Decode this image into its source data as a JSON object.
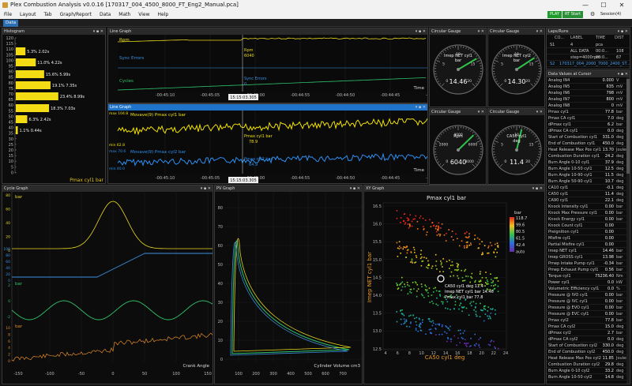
{
  "app": {
    "title": "Plex Combustion Analysis v0.0.16  [170317_004_4500_8000_FT_Eng2_Manual.pca]",
    "minimize": "—",
    "maximize": "☐",
    "close": "✕"
  },
  "menu": [
    "File",
    "Layout",
    "Tab",
    "Graph/Report",
    "Data",
    "Math",
    "View",
    "Help"
  ],
  "controls": {
    "play": "PLAY",
    "rtstart": "RT Start",
    "sessions": "Session(4)"
  },
  "tabs": {
    "active": "Data"
  },
  "histogram": {
    "title": "Histogram",
    "bars": [
      {
        "label": "5.3% 2.02s",
        "pct": 5.3
      },
      {
        "label": "11.0% 4.22s",
        "pct": 11.0
      },
      {
        "label": "15.6% 5.99s",
        "pct": 15.6
      },
      {
        "label": "19.1% 7.35s",
        "pct": 19.1
      },
      {
        "label": "23.4% 8.99s",
        "pct": 23.4
      },
      {
        "label": "18.3% 7.03s",
        "pct": 18.3
      },
      {
        "label": "6.3% 2.42s",
        "pct": 6.3
      },
      {
        "label": "1.1% 0.44s",
        "pct": 1.1
      }
    ],
    "yticks": [
      "120",
      "115",
      "110",
      "105",
      "100",
      "95",
      "90",
      "85",
      "80",
      "75",
      "70",
      "65",
      "60",
      "55",
      "50",
      "45",
      "40",
      "35",
      "30",
      "25",
      "20",
      "15",
      "10",
      "5",
      "0"
    ],
    "axis_label": "Pmax cyl1 bar"
  },
  "line_graph1": {
    "title": "Line Graph",
    "labels": {
      "rpm": "Rpm",
      "sync": "Sync Errors",
      "cycles": "Cycles",
      "time": "Time",
      "cursor_rpm": "Rpm",
      "cursor_rpm_val": "6040",
      "cursor_sync": "Sync Errors",
      "cursor_sync_val": "0"
    },
    "xticks": [
      "-00:45:10",
      "-00:45:05",
      "-00:45:00",
      "-00:44:55",
      "-00:44:50",
      "-00:44:45",
      "-00:44:40"
    ],
    "cursor_time": "15:15:03.305"
  },
  "line_graph2": {
    "title": "Line Graph",
    "labels": {
      "movave1": "Movave(9)  Pmax cyl1 bar",
      "movave2": "Movave(9)  Pmax cyl2 bar",
      "time": "Time",
      "max": "max 104.8",
      "min": "min 62.8",
      "max2": "max 70.6",
      "min2": "min 40.0",
      "c1": "Pmax cyl1 bar",
      "c1v": "78.9",
      "c2": "Pmax cyl2 bar",
      "c2v": "64.9"
    },
    "xticks": [
      "-00:45:10",
      "-00:45:05",
      "-00:45:00",
      "-00:44:55",
      "-00:44:50",
      "-00:44:45",
      "-00:44:40"
    ],
    "cursor_time": "15:15:03.305"
  },
  "gauges": [
    {
      "title": "Circular Gauge",
      "name": "Imep NET cyl1",
      "unit": "bar",
      "value": "14.46",
      "needle": 0.72,
      "ticks": [
        "0",
        "5",
        "10",
        "15",
        "20"
      ]
    },
    {
      "title": "Circular Gauge",
      "name": "Imep NET cyl2",
      "unit": "bar",
      "value": "14.30",
      "needle": 0.71,
      "ticks": [
        "0",
        "5",
        "10",
        "15",
        "20"
      ]
    },
    {
      "title": "Circular Gauge",
      "name": "Rpm",
      "unit": "",
      "value": "6040",
      "needle": 0.67,
      "ticks": [
        "0",
        "2000",
        "4000",
        "6000",
        "8000"
      ]
    },
    {
      "title": "Circular Gauge",
      "name": "CA50 cyl1",
      "unit": "deg",
      "value": "11.4",
      "needle": 0.55,
      "ticks": [
        "0",
        "5",
        "10",
        "15",
        "20"
      ]
    }
  ],
  "laps": {
    "title": "Laps/Runs",
    "headers": [
      "CO...",
      "LABEL",
      "TIME",
      "DIST"
    ],
    "rows": [
      [
        "S1",
        "4",
        "pca",
        ""
      ],
      [
        "",
        "ALL DATA",
        "00:0...",
        "108"
      ],
      [
        "",
        "step=4000rpm",
        "00:0...",
        "67"
      ],
      [
        "S2",
        "170317_004_2000_7000_2400_ST...",
        "",
        ""
      ]
    ]
  },
  "datavalues": {
    "title": "Data Values at Cursor",
    "rows": [
      [
        "Analog IN4",
        "0.000",
        "V"
      ],
      [
        "Analog IN5",
        "635",
        "mV"
      ],
      [
        "Analog IN6",
        "798",
        "mV"
      ],
      [
        "Analog IN7",
        "800",
        "mV"
      ],
      [
        "Analog IN8",
        "0",
        "mV"
      ],
      [
        "Pmax cyl1",
        "77.8",
        "bar"
      ],
      [
        "Pmax CA cyl1",
        "7.0",
        "deg"
      ],
      [
        "dPmax cyl1",
        "6.2",
        "bar"
      ],
      [
        "dPmax CA cyl1",
        "0.0",
        "deg"
      ],
      [
        "Start of Combustion cyl1",
        "331.0",
        "deg"
      ],
      [
        "End of Combustion cyl1",
        "450.0",
        "deg"
      ],
      [
        "Heat Release Max Pos cyl1",
        "13.70",
        "Joules"
      ],
      [
        "Combustion Duration cyl1",
        "24.2",
        "deg"
      ],
      [
        "Burn Angle 0-10 cyl1",
        "37.9",
        "deg"
      ],
      [
        "Burn Angle 10-50 cyl1",
        "12.5",
        "deg"
      ],
      [
        "Burn Angle 10-90 cyl1",
        "11.5",
        "deg"
      ],
      [
        "Burn Angle 50-90 cyl1",
        "10.7",
        "deg"
      ],
      [
        "CA10 cyl1",
        "-0.1",
        "deg"
      ],
      [
        "CA50 cyl1",
        "11.4",
        "deg"
      ],
      [
        "CA90 cyl1",
        "22.1",
        "deg"
      ],
      [
        "Knock Intensity cyl1",
        "0.00",
        "bar"
      ],
      [
        "Knock Max Pressure cyl1",
        "0.00",
        "bar"
      ],
      [
        "Knock Energy cyl1",
        "0.00",
        "bar"
      ],
      [
        "Knock Count cyl1",
        "0.00",
        ""
      ],
      [
        "Preignition cyl1",
        "0.00",
        ""
      ],
      [
        "Misfire cyl1",
        "0.00",
        ""
      ],
      [
        "Partial Misfire cyl1",
        "0.00",
        ""
      ],
      [
        "Imep NET cyl1",
        "14.46",
        "bar"
      ],
      [
        "Imep GROSS cyl1",
        "13.98",
        "bar"
      ],
      [
        "Pmep Intake Pump cyl1",
        "-0.34",
        "bar"
      ],
      [
        "Pmep Exhaust Pump cyl1",
        "0.56",
        "bar"
      ],
      [
        "Torque cyl1",
        "75236.40",
        "Nm"
      ],
      [
        "Power cyl1",
        "0.0",
        "kW"
      ],
      [
        "Volumetric Efficiency cyl1",
        "0.0",
        "%"
      ],
      [
        "Pressure @ IVO cyl1",
        "0.00",
        "bar"
      ],
      [
        "Pressure @ IVC cyl1",
        "0.00",
        "bar"
      ],
      [
        "Pressure @ EVO cyl1",
        "0.00",
        "bar"
      ],
      [
        "Pressure @ EVC cyl1",
        "0.00",
        "bar"
      ],
      [
        "Pmax cyl2",
        "77.8",
        "bar"
      ],
      [
        "Pmax CA cyl2",
        "15.0",
        "deg"
      ],
      [
        "dPmax cyl2",
        "2.7",
        "bar"
      ],
      [
        "dPmax CA cyl2",
        "0.0",
        "deg"
      ],
      [
        "Start of Combustion cyl2",
        "330.0",
        "deg"
      ],
      [
        "End of Combustion cyl2",
        "450.0",
        "deg"
      ],
      [
        "Heat Release Max Pos cyl2",
        "11.85",
        "Joules"
      ],
      [
        "Combustion Duration cyl2",
        "29.8",
        "deg"
      ],
      [
        "Burn Angle 0-10 cyl2",
        "33.2",
        "deg"
      ],
      [
        "Burn Angle 10-50 cyl2",
        "14.8",
        "deg"
      ]
    ]
  },
  "cycle": {
    "title": "Cycle Graph",
    "labels": {
      "bar1": "bar",
      "bar2": "bar",
      "bar3": "bar",
      "xlabel": "Crank Angle"
    },
    "xticks": [
      "-150",
      "-100",
      "-50",
      "0",
      "50",
      "100",
      "150"
    ],
    "y1": [
      "80",
      "60",
      "40",
      "20",
      "0"
    ],
    "y2": [
      "100",
      "80",
      "60",
      "40",
      "20",
      "0"
    ],
    "y3": [
      "2",
      "0",
      "-2"
    ],
    "y4": [
      "10",
      "8",
      "6",
      "4",
      "2",
      "0"
    ]
  },
  "pv": {
    "title": "PV Graph",
    "xlabel": "Cylinder Volume cm3",
    "xticks": [
      "100",
      "200",
      "300",
      "400",
      "500",
      "600",
      "700"
    ],
    "yticks": [
      "80",
      "70",
      "60",
      "50",
      "40",
      "30",
      "20",
      "10",
      "0"
    ]
  },
  "xy": {
    "title": "XY Graph",
    "chart_title": "Pmax cyl1 bar",
    "xlabel": "CA50 cyl1 deg",
    "ylabel": "Imep NET cyl1 bar",
    "xticks": [
      "4",
      "6",
      "8",
      "10",
      "12",
      "14",
      "16",
      "18",
      "20",
      "22",
      "24"
    ],
    "yticks": [
      "16.5",
      "16.0",
      "15.5",
      "15.0",
      "14.5",
      "14.0",
      "13.5",
      "13.0",
      "12.5"
    ],
    "legend_title": "bar",
    "legend": [
      "118.7",
      "99.6",
      "80.5",
      "61.5",
      "42.4",
      "auto"
    ],
    "tip1": "CA50 cyl1 deg 11.4",
    "tip2": "Imep NET cyl1 bar 14.46",
    "tip3": "Pmax cyl1 bar 77.8"
  }
}
